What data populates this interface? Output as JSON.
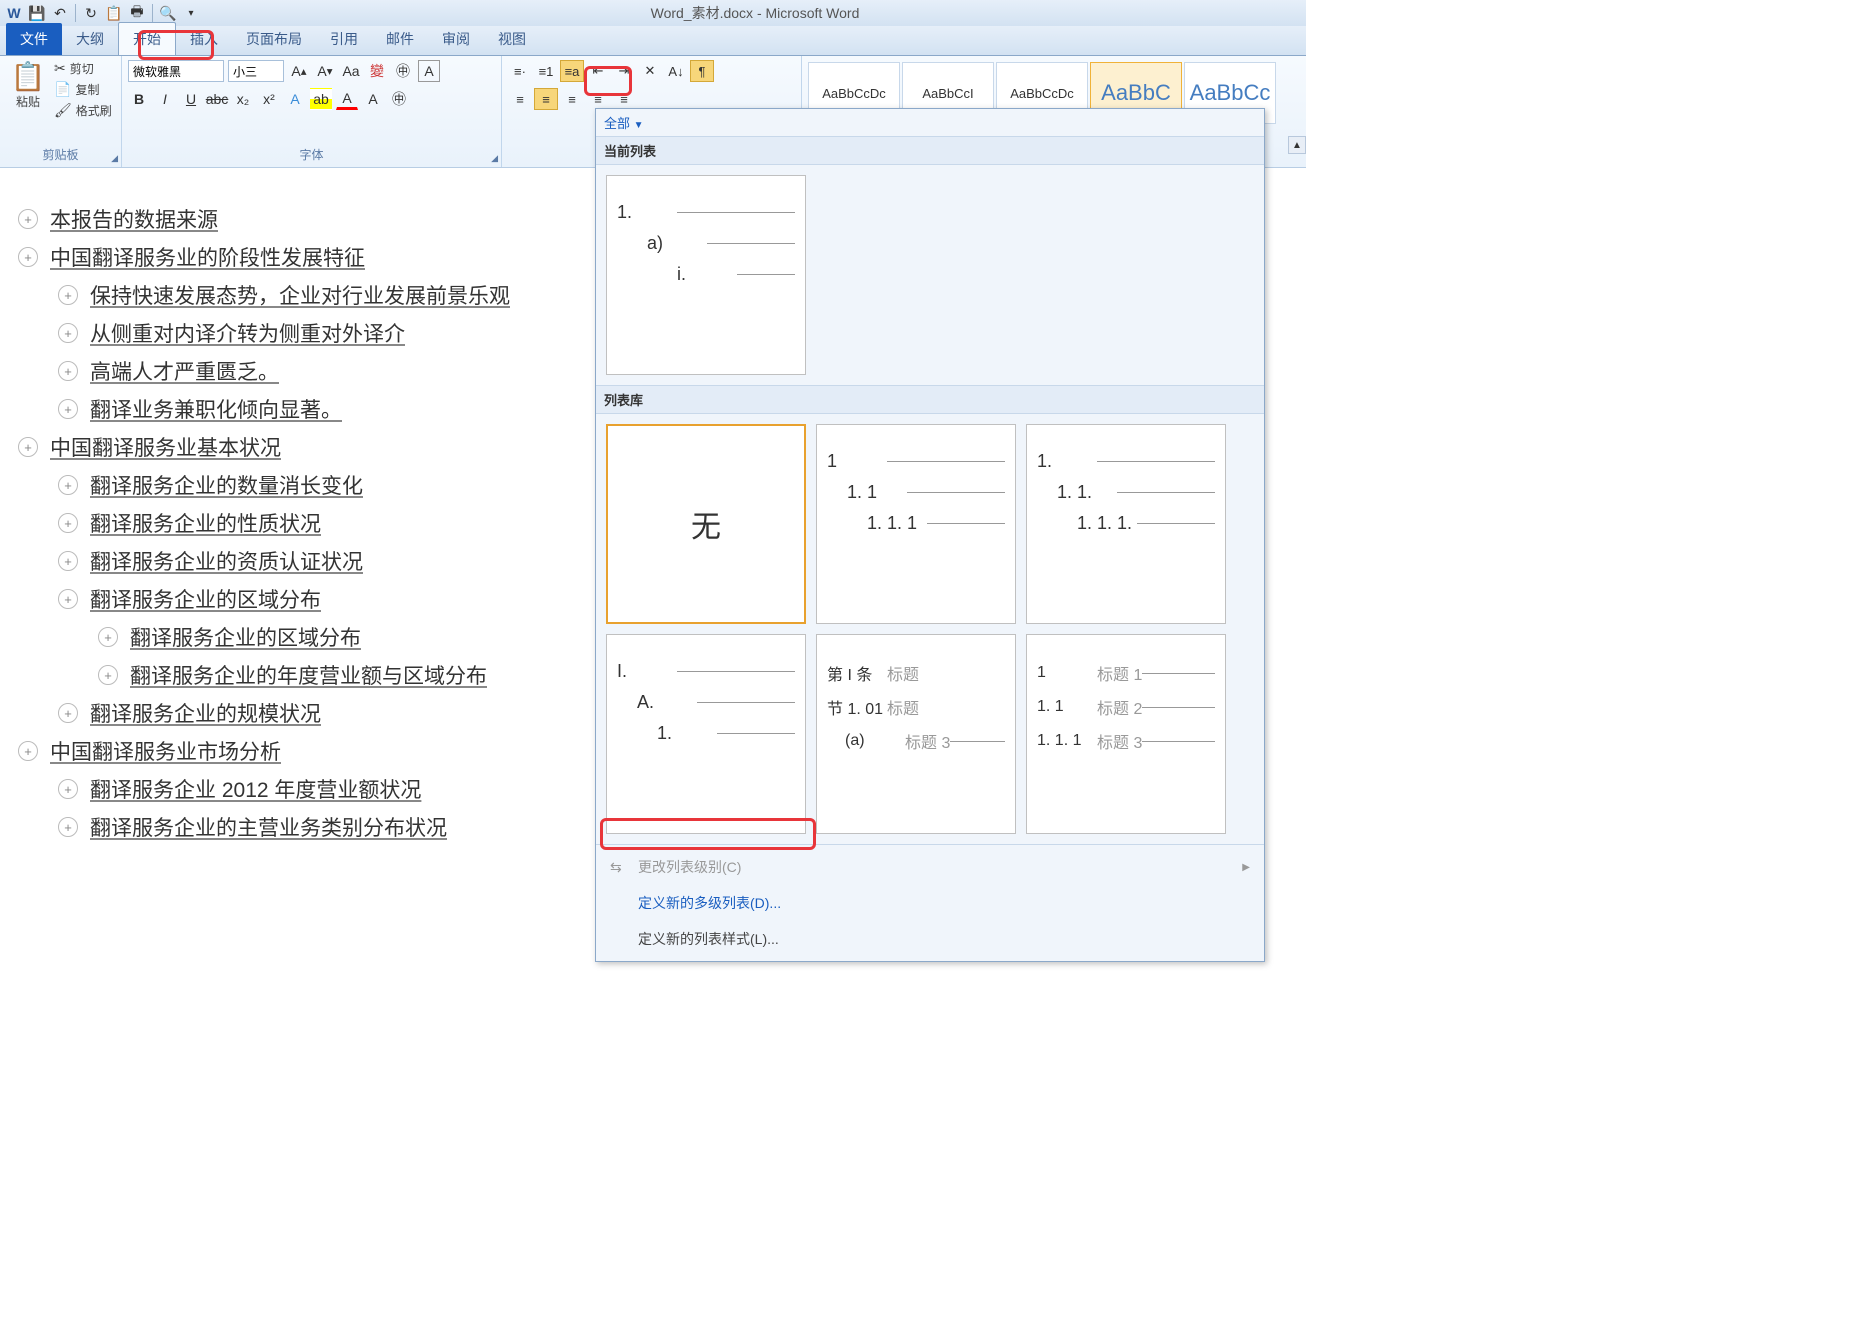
{
  "qat": {
    "title": "Word_素材.docx - Microsoft Word"
  },
  "tabs": {
    "file": "文件",
    "outline": "大纲",
    "home": "开始",
    "insert": "插入",
    "layout": "页面布局",
    "ref": "引用",
    "mail": "邮件",
    "review": "审阅",
    "view": "视图"
  },
  "clipboard": {
    "paste": "粘贴",
    "cut": "剪切",
    "copy": "复制",
    "format": "格式刷",
    "label": "剪贴板"
  },
  "font": {
    "name": "微软雅黑",
    "size": "小三",
    "label": "字体"
  },
  "styles": {
    "s1": "AaBbCcDc",
    "s2": "AaBbCcI",
    "s3": "AaBbCcDc",
    "s4": "AaBbC",
    "s5": "AaBbCc"
  },
  "outline": [
    {
      "lvl": 1,
      "t": "本报告的数据来源"
    },
    {
      "lvl": 1,
      "t": "中国翻译服务业的阶段性发展特征"
    },
    {
      "lvl": 2,
      "t": "保持快速发展态势，企业对行业发展前景乐观"
    },
    {
      "lvl": 2,
      "t": "从侧重对内译介转为侧重对外译介"
    },
    {
      "lvl": 2,
      "t": "高端人才严重匮乏。"
    },
    {
      "lvl": 2,
      "t": "翻译业务兼职化倾向显著。"
    },
    {
      "lvl": 1,
      "t": "中国翻译服务业基本状况"
    },
    {
      "lvl": 2,
      "t": "翻译服务企业的数量消长变化"
    },
    {
      "lvl": 2,
      "t": "翻译服务企业的性质状况"
    },
    {
      "lvl": 2,
      "t": "翻译服务企业的资质认证状况"
    },
    {
      "lvl": 2,
      "t": "翻译服务企业的区域分布"
    },
    {
      "lvl": 3,
      "t": "翻译服务企业的区域分布"
    },
    {
      "lvl": 3,
      "t": "翻译服务企业的年度营业额与区域分布"
    },
    {
      "lvl": 2,
      "t": "翻译服务企业的规模状况"
    },
    {
      "lvl": 1,
      "t": "中国翻译服务业市场分析"
    },
    {
      "lvl": 2,
      "t": "翻译服务企业 2012 年度营业额状况"
    },
    {
      "lvl": 2,
      "t": "翻译服务企业的主营业务类别分布状况"
    }
  ],
  "dropdown": {
    "all": "全部",
    "current": "当前列表",
    "library": "列表库",
    "none": "无",
    "lib2": {
      "a": "1",
      "b": "1. 1",
      "c": "1. 1. 1"
    },
    "lib3": {
      "a": "1.",
      "b": "1. 1.",
      "c": "1. 1. 1."
    },
    "lib4": {
      "a": "I.",
      "b": "A.",
      "c": "1."
    },
    "lib5": {
      "a": "第 I 条",
      "at": "标题",
      "b": "节 1. 01",
      "bt": "标题",
      "c": "(a)",
      "ct": "标题 3"
    },
    "lib6": {
      "a": "1",
      "at": "标题 1",
      "b": "1. 1",
      "bt": "标题 2",
      "c": "1. 1. 1",
      "ct": "标题 3"
    },
    "change_level": "更改列表级别(C)",
    "define_new": "定义新的多级列表(D)...",
    "define_style": "定义新的列表样式(L)..."
  }
}
